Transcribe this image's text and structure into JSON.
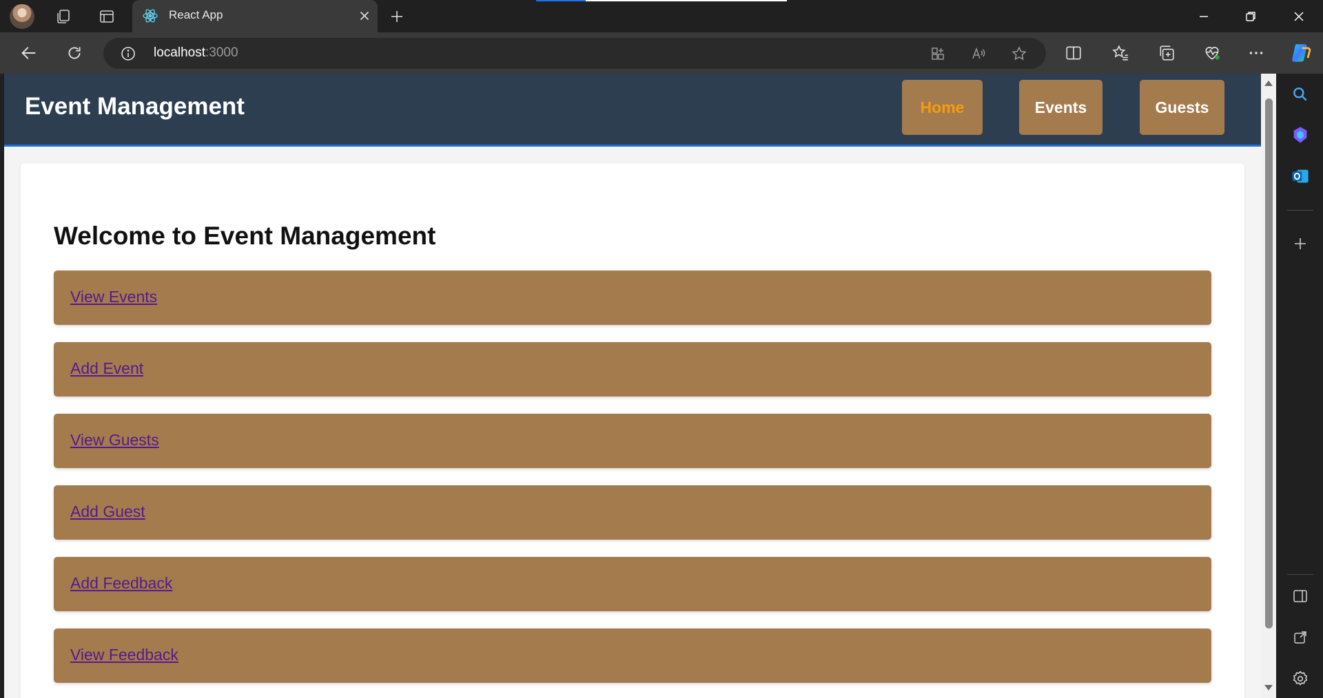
{
  "browser": {
    "tab_title": "React App",
    "address_host": "localhost",
    "address_port": ":3000"
  },
  "app": {
    "title": "Event Management",
    "nav": [
      {
        "label": "Home",
        "active": true
      },
      {
        "label": "Events",
        "active": false
      },
      {
        "label": "Guests",
        "active": false
      }
    ],
    "heading": "Welcome to Event Management",
    "links": [
      {
        "label": "View Events"
      },
      {
        "label": "Add Event"
      },
      {
        "label": "View Guests"
      },
      {
        "label": "Add Guest"
      },
      {
        "label": "Add Feedback"
      },
      {
        "label": "View Feedback"
      }
    ]
  },
  "colors": {
    "header_bg": "#2c3e50",
    "accent_brown": "#a47b4d",
    "active_nav_text": "#f39c12",
    "link_color": "#551a8b"
  },
  "icons": {
    "tabbar": [
      "profile-avatar",
      "workspaces-icon",
      "tab-actions-icon",
      "react-icon",
      "close-tab-icon",
      "new-tab-icon",
      "minimize-icon",
      "restore-icon",
      "close-window-icon"
    ],
    "toolbar": [
      "back-icon",
      "refresh-icon",
      "site-info-icon",
      "app-available-icon",
      "read-aloud-icon",
      "favorite-star-icon",
      "split-screen-icon",
      "favorites-icon",
      "collections-icon",
      "browser-essentials-icon",
      "more-icon",
      "copilot-icon"
    ],
    "sidebar": [
      "search-icon",
      "copilot-sidebar-icon",
      "outlook-icon",
      "add-icon",
      "sidebar-toggle-icon",
      "open-external-icon",
      "settings-icon"
    ]
  }
}
